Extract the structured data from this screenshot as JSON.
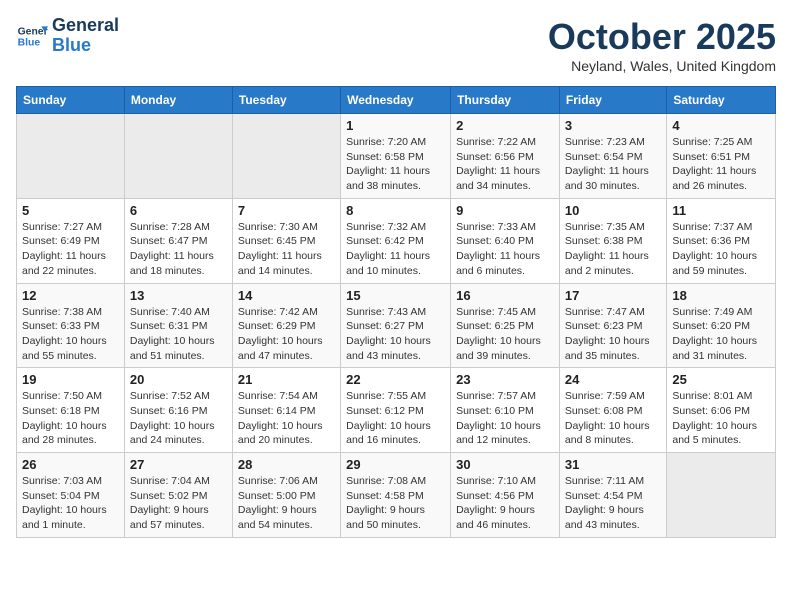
{
  "logo": {
    "line1": "General",
    "line2": "Blue"
  },
  "title": "October 2025",
  "location": "Neyland, Wales, United Kingdom",
  "days_of_week": [
    "Sunday",
    "Monday",
    "Tuesday",
    "Wednesday",
    "Thursday",
    "Friday",
    "Saturday"
  ],
  "weeks": [
    [
      {
        "num": "",
        "detail": ""
      },
      {
        "num": "",
        "detail": ""
      },
      {
        "num": "",
        "detail": ""
      },
      {
        "num": "1",
        "detail": "Sunrise: 7:20 AM\nSunset: 6:58 PM\nDaylight: 11 hours\nand 38 minutes."
      },
      {
        "num": "2",
        "detail": "Sunrise: 7:22 AM\nSunset: 6:56 PM\nDaylight: 11 hours\nand 34 minutes."
      },
      {
        "num": "3",
        "detail": "Sunrise: 7:23 AM\nSunset: 6:54 PM\nDaylight: 11 hours\nand 30 minutes."
      },
      {
        "num": "4",
        "detail": "Sunrise: 7:25 AM\nSunset: 6:51 PM\nDaylight: 11 hours\nand 26 minutes."
      }
    ],
    [
      {
        "num": "5",
        "detail": "Sunrise: 7:27 AM\nSunset: 6:49 PM\nDaylight: 11 hours\nand 22 minutes."
      },
      {
        "num": "6",
        "detail": "Sunrise: 7:28 AM\nSunset: 6:47 PM\nDaylight: 11 hours\nand 18 minutes."
      },
      {
        "num": "7",
        "detail": "Sunrise: 7:30 AM\nSunset: 6:45 PM\nDaylight: 11 hours\nand 14 minutes."
      },
      {
        "num": "8",
        "detail": "Sunrise: 7:32 AM\nSunset: 6:42 PM\nDaylight: 11 hours\nand 10 minutes."
      },
      {
        "num": "9",
        "detail": "Sunrise: 7:33 AM\nSunset: 6:40 PM\nDaylight: 11 hours\nand 6 minutes."
      },
      {
        "num": "10",
        "detail": "Sunrise: 7:35 AM\nSunset: 6:38 PM\nDaylight: 11 hours\nand 2 minutes."
      },
      {
        "num": "11",
        "detail": "Sunrise: 7:37 AM\nSunset: 6:36 PM\nDaylight: 10 hours\nand 59 minutes."
      }
    ],
    [
      {
        "num": "12",
        "detail": "Sunrise: 7:38 AM\nSunset: 6:33 PM\nDaylight: 10 hours\nand 55 minutes."
      },
      {
        "num": "13",
        "detail": "Sunrise: 7:40 AM\nSunset: 6:31 PM\nDaylight: 10 hours\nand 51 minutes."
      },
      {
        "num": "14",
        "detail": "Sunrise: 7:42 AM\nSunset: 6:29 PM\nDaylight: 10 hours\nand 47 minutes."
      },
      {
        "num": "15",
        "detail": "Sunrise: 7:43 AM\nSunset: 6:27 PM\nDaylight: 10 hours\nand 43 minutes."
      },
      {
        "num": "16",
        "detail": "Sunrise: 7:45 AM\nSunset: 6:25 PM\nDaylight: 10 hours\nand 39 minutes."
      },
      {
        "num": "17",
        "detail": "Sunrise: 7:47 AM\nSunset: 6:23 PM\nDaylight: 10 hours\nand 35 minutes."
      },
      {
        "num": "18",
        "detail": "Sunrise: 7:49 AM\nSunset: 6:20 PM\nDaylight: 10 hours\nand 31 minutes."
      }
    ],
    [
      {
        "num": "19",
        "detail": "Sunrise: 7:50 AM\nSunset: 6:18 PM\nDaylight: 10 hours\nand 28 minutes."
      },
      {
        "num": "20",
        "detail": "Sunrise: 7:52 AM\nSunset: 6:16 PM\nDaylight: 10 hours\nand 24 minutes."
      },
      {
        "num": "21",
        "detail": "Sunrise: 7:54 AM\nSunset: 6:14 PM\nDaylight: 10 hours\nand 20 minutes."
      },
      {
        "num": "22",
        "detail": "Sunrise: 7:55 AM\nSunset: 6:12 PM\nDaylight: 10 hours\nand 16 minutes."
      },
      {
        "num": "23",
        "detail": "Sunrise: 7:57 AM\nSunset: 6:10 PM\nDaylight: 10 hours\nand 12 minutes."
      },
      {
        "num": "24",
        "detail": "Sunrise: 7:59 AM\nSunset: 6:08 PM\nDaylight: 10 hours\nand 8 minutes."
      },
      {
        "num": "25",
        "detail": "Sunrise: 8:01 AM\nSunset: 6:06 PM\nDaylight: 10 hours\nand 5 minutes."
      }
    ],
    [
      {
        "num": "26",
        "detail": "Sunrise: 7:03 AM\nSunset: 5:04 PM\nDaylight: 10 hours\nand 1 minute."
      },
      {
        "num": "27",
        "detail": "Sunrise: 7:04 AM\nSunset: 5:02 PM\nDaylight: 9 hours\nand 57 minutes."
      },
      {
        "num": "28",
        "detail": "Sunrise: 7:06 AM\nSunset: 5:00 PM\nDaylight: 9 hours\nand 54 minutes."
      },
      {
        "num": "29",
        "detail": "Sunrise: 7:08 AM\nSunset: 4:58 PM\nDaylight: 9 hours\nand 50 minutes."
      },
      {
        "num": "30",
        "detail": "Sunrise: 7:10 AM\nSunset: 4:56 PM\nDaylight: 9 hours\nand 46 minutes."
      },
      {
        "num": "31",
        "detail": "Sunrise: 7:11 AM\nSunset: 4:54 PM\nDaylight: 9 hours\nand 43 minutes."
      },
      {
        "num": "",
        "detail": ""
      }
    ]
  ]
}
